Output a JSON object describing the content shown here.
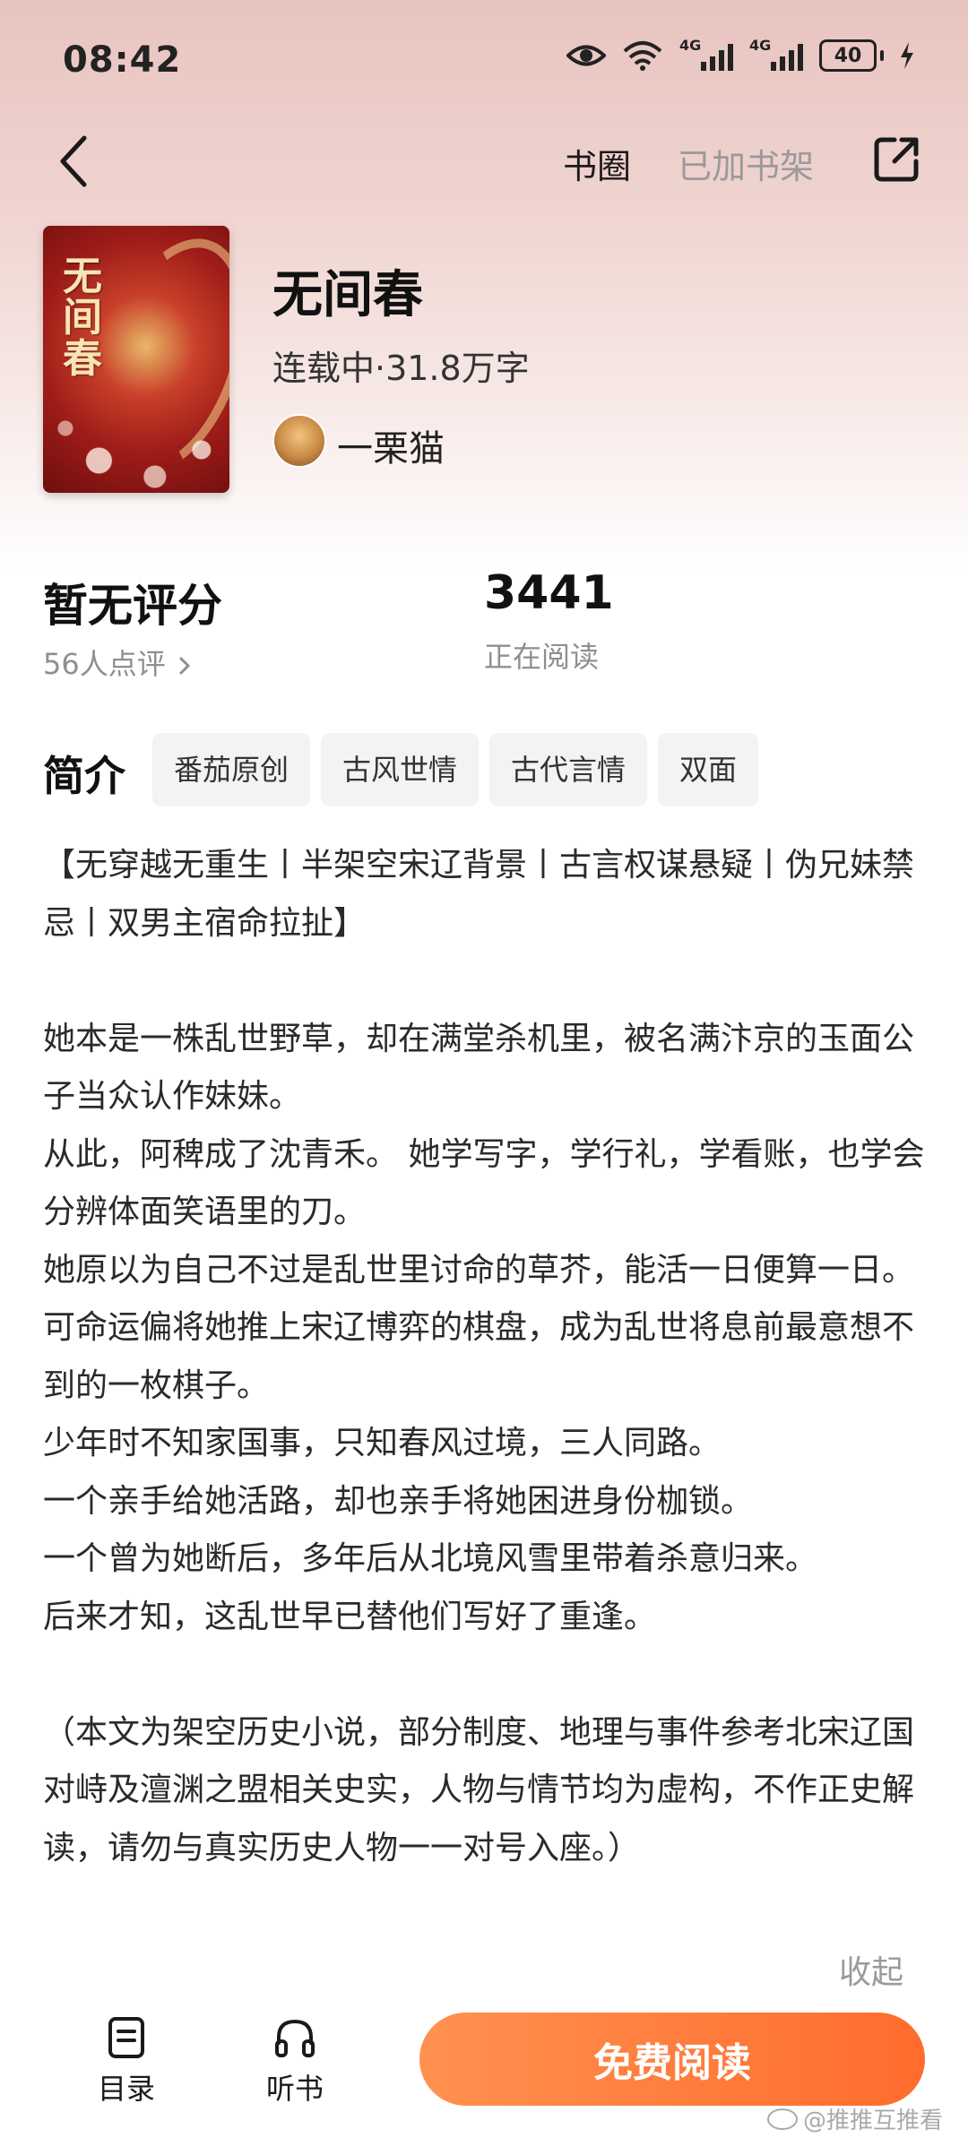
{
  "status_bar": {
    "time": "08:42",
    "network1": "4G",
    "network2": "4G",
    "battery": "40",
    "icons": [
      "eye-icon",
      "wifi-icon",
      "signal-icon",
      "signal-icon",
      "battery-icon",
      "charging-icon"
    ]
  },
  "nav": {
    "back_icon": "chevron-left-icon",
    "shuquan": "书圈",
    "added": "已加书架",
    "share_icon": "share-icon"
  },
  "book": {
    "cover_title": "无间春",
    "title": "无间春",
    "meta": "连载中·31.8万字",
    "author": "一栗猫"
  },
  "stats": {
    "rating_title": "暂无评分",
    "rating_count": "56人点评",
    "reading_count": "3441",
    "reading_label": "正在阅读"
  },
  "intro": {
    "label": "简介",
    "tags": [
      "番茄原创",
      "古风世情",
      "古代言情",
      "双面"
    ],
    "paragraphs": [
      "【无穿越无重生丨半架空宋辽背景丨古言权谋悬疑丨伪兄妹禁忌丨双男主宿命拉扯】",
      "",
      "她本是一株乱世野草，却在满堂杀机里，被名满汴京的玉面公子当众认作妹妹。",
      "从此，阿稗成了沈青禾。 她学写字，学行礼，学看账，也学会分辨体面笑语里的刀。",
      "她原以为自己不过是乱世里讨命的草芥，能活一日便算一日。",
      "可命运偏将她推上宋辽博弈的棋盘，成为乱世将息前最意想不到的一枚棋子。",
      "少年时不知家国事，只知春风过境，三人同路。",
      "一个亲手给她活路，却也亲手将她困进身份枷锁。",
      "一个曾为她断后，多年后从北境风雪里带着杀意归来。",
      "后来才知，这乱世早已替他们写好了重逢。",
      "",
      "（本文为架空历史小说，部分制度、地理与事件参考北宋辽国对峙及澶渊之盟相关史实，人物与情节均为虚构，不作正史解读，请勿与真实历史人物一一对号入座。）"
    ],
    "collapse": "收起"
  },
  "bottom": {
    "catalog": "目录",
    "listen": "听书",
    "read": "免费阅读",
    "watermark": "@推推互推看"
  },
  "colors": {
    "accent": "#ff7a35",
    "header_bg": "#ecc9c5",
    "muted": "#9a9a9a"
  }
}
